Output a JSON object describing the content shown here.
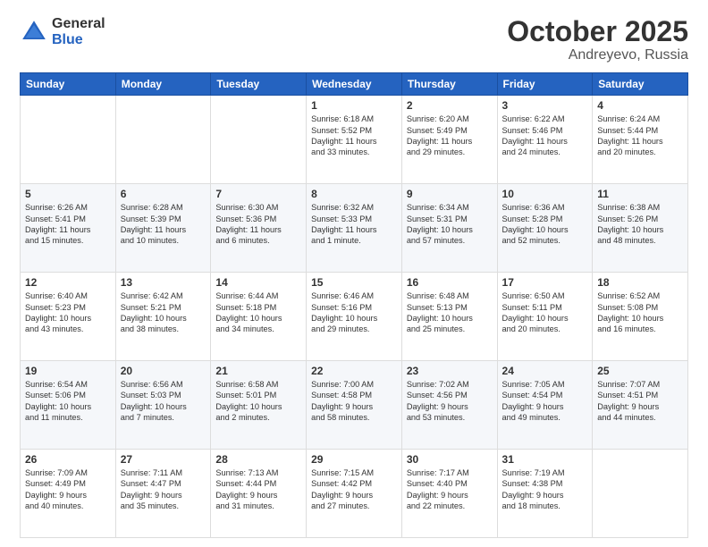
{
  "header": {
    "logo_general": "General",
    "logo_blue": "Blue",
    "month": "October 2025",
    "location": "Andreyevo, Russia"
  },
  "weekdays": [
    "Sunday",
    "Monday",
    "Tuesday",
    "Wednesday",
    "Thursday",
    "Friday",
    "Saturday"
  ],
  "weeks": [
    [
      {
        "day": "",
        "info": ""
      },
      {
        "day": "",
        "info": ""
      },
      {
        "day": "",
        "info": ""
      },
      {
        "day": "1",
        "info": "Sunrise: 6:18 AM\nSunset: 5:52 PM\nDaylight: 11 hours\nand 33 minutes."
      },
      {
        "day": "2",
        "info": "Sunrise: 6:20 AM\nSunset: 5:49 PM\nDaylight: 11 hours\nand 29 minutes."
      },
      {
        "day": "3",
        "info": "Sunrise: 6:22 AM\nSunset: 5:46 PM\nDaylight: 11 hours\nand 24 minutes."
      },
      {
        "day": "4",
        "info": "Sunrise: 6:24 AM\nSunset: 5:44 PM\nDaylight: 11 hours\nand 20 minutes."
      }
    ],
    [
      {
        "day": "5",
        "info": "Sunrise: 6:26 AM\nSunset: 5:41 PM\nDaylight: 11 hours\nand 15 minutes."
      },
      {
        "day": "6",
        "info": "Sunrise: 6:28 AM\nSunset: 5:39 PM\nDaylight: 11 hours\nand 10 minutes."
      },
      {
        "day": "7",
        "info": "Sunrise: 6:30 AM\nSunset: 5:36 PM\nDaylight: 11 hours\nand 6 minutes."
      },
      {
        "day": "8",
        "info": "Sunrise: 6:32 AM\nSunset: 5:33 PM\nDaylight: 11 hours\nand 1 minute."
      },
      {
        "day": "9",
        "info": "Sunrise: 6:34 AM\nSunset: 5:31 PM\nDaylight: 10 hours\nand 57 minutes."
      },
      {
        "day": "10",
        "info": "Sunrise: 6:36 AM\nSunset: 5:28 PM\nDaylight: 10 hours\nand 52 minutes."
      },
      {
        "day": "11",
        "info": "Sunrise: 6:38 AM\nSunset: 5:26 PM\nDaylight: 10 hours\nand 48 minutes."
      }
    ],
    [
      {
        "day": "12",
        "info": "Sunrise: 6:40 AM\nSunset: 5:23 PM\nDaylight: 10 hours\nand 43 minutes."
      },
      {
        "day": "13",
        "info": "Sunrise: 6:42 AM\nSunset: 5:21 PM\nDaylight: 10 hours\nand 38 minutes."
      },
      {
        "day": "14",
        "info": "Sunrise: 6:44 AM\nSunset: 5:18 PM\nDaylight: 10 hours\nand 34 minutes."
      },
      {
        "day": "15",
        "info": "Sunrise: 6:46 AM\nSunset: 5:16 PM\nDaylight: 10 hours\nand 29 minutes."
      },
      {
        "day": "16",
        "info": "Sunrise: 6:48 AM\nSunset: 5:13 PM\nDaylight: 10 hours\nand 25 minutes."
      },
      {
        "day": "17",
        "info": "Sunrise: 6:50 AM\nSunset: 5:11 PM\nDaylight: 10 hours\nand 20 minutes."
      },
      {
        "day": "18",
        "info": "Sunrise: 6:52 AM\nSunset: 5:08 PM\nDaylight: 10 hours\nand 16 minutes."
      }
    ],
    [
      {
        "day": "19",
        "info": "Sunrise: 6:54 AM\nSunset: 5:06 PM\nDaylight: 10 hours\nand 11 minutes."
      },
      {
        "day": "20",
        "info": "Sunrise: 6:56 AM\nSunset: 5:03 PM\nDaylight: 10 hours\nand 7 minutes."
      },
      {
        "day": "21",
        "info": "Sunrise: 6:58 AM\nSunset: 5:01 PM\nDaylight: 10 hours\nand 2 minutes."
      },
      {
        "day": "22",
        "info": "Sunrise: 7:00 AM\nSunset: 4:58 PM\nDaylight: 9 hours\nand 58 minutes."
      },
      {
        "day": "23",
        "info": "Sunrise: 7:02 AM\nSunset: 4:56 PM\nDaylight: 9 hours\nand 53 minutes."
      },
      {
        "day": "24",
        "info": "Sunrise: 7:05 AM\nSunset: 4:54 PM\nDaylight: 9 hours\nand 49 minutes."
      },
      {
        "day": "25",
        "info": "Sunrise: 7:07 AM\nSunset: 4:51 PM\nDaylight: 9 hours\nand 44 minutes."
      }
    ],
    [
      {
        "day": "26",
        "info": "Sunrise: 7:09 AM\nSunset: 4:49 PM\nDaylight: 9 hours\nand 40 minutes."
      },
      {
        "day": "27",
        "info": "Sunrise: 7:11 AM\nSunset: 4:47 PM\nDaylight: 9 hours\nand 35 minutes."
      },
      {
        "day": "28",
        "info": "Sunrise: 7:13 AM\nSunset: 4:44 PM\nDaylight: 9 hours\nand 31 minutes."
      },
      {
        "day": "29",
        "info": "Sunrise: 7:15 AM\nSunset: 4:42 PM\nDaylight: 9 hours\nand 27 minutes."
      },
      {
        "day": "30",
        "info": "Sunrise: 7:17 AM\nSunset: 4:40 PM\nDaylight: 9 hours\nand 22 minutes."
      },
      {
        "day": "31",
        "info": "Sunrise: 7:19 AM\nSunset: 4:38 PM\nDaylight: 9 hours\nand 18 minutes."
      },
      {
        "day": "",
        "info": ""
      }
    ]
  ]
}
